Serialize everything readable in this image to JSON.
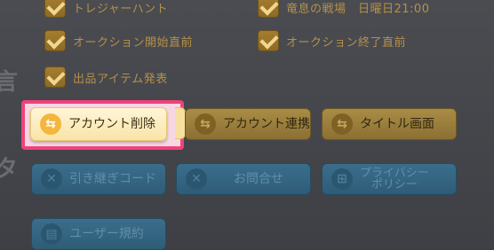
{
  "checkboxes": [
    {
      "label": "トレジャーハント",
      "checked": true
    },
    {
      "label": "竜息の戦場　日曜日21:00",
      "checked": true
    },
    {
      "label": "オークション開始直前",
      "checked": true
    },
    {
      "label": "オークション終了直前",
      "checked": true
    },
    {
      "label": "出品アイテム発表",
      "checked": true
    }
  ],
  "buttons": {
    "delete_account": "アカウント削除",
    "link_account": "アカウント連携",
    "title_screen": "タイトル画面",
    "transfer_code": "引き継ぎコード",
    "contact": "お問合せ",
    "privacy_line1": "プライバシー",
    "privacy_line2": "ポリシー",
    "terms": "ユーザー規約"
  },
  "icons": {
    "swap": "swap-arrows-icon",
    "x": "x-circle-icon",
    "window": "window-grid-icon",
    "document": "document-icon"
  },
  "colors": {
    "highlight": "#f0427a",
    "gold_button": "#a98c45",
    "blue_button": "#3a6e8c",
    "checkbox_text": "#b6904a"
  }
}
